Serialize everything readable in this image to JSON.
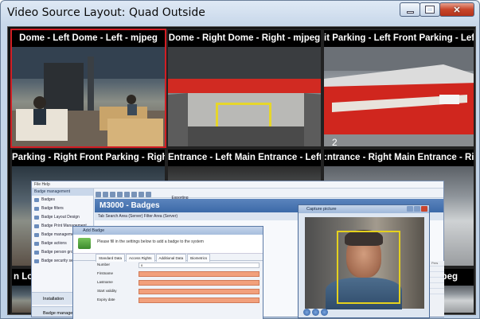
{
  "window": {
    "title": "Video Source Layout: Quad Outside",
    "controls": {
      "minimize": "minimize",
      "maximize": "maximize",
      "close": "close"
    }
  },
  "tiles": [
    {
      "label": "Dome - Left Dome - Left - mjpeg",
      "active": true
    },
    {
      "label": "Dome - Right Dome - Right - mjpeg",
      "active": false
    },
    {
      "label": "it Parking - Left Front Parking - Left - m",
      "active": false
    },
    {
      "label": "Parking - Right Front Parking - Right - r",
      "active": false
    },
    {
      "label": "Entrance - Left Main Entrance - Left - n",
      "active": false
    },
    {
      "label": ":ntrance - Right Main Entrance - Right - m",
      "active": false
    },
    {
      "label": "n Lo",
      "active": false
    },
    {
      "label": "njpeg",
      "active": false
    }
  ],
  "overlay_app": {
    "menubar": "File   Help",
    "nav_header": "Badge management",
    "nav_items": [
      "Badges",
      "Badge filters",
      "Badge Layout Design",
      "Badge Print Management",
      "Badge management",
      "Badge actions",
      "Badge person groups",
      "Badge security settings"
    ],
    "nav_bottom_1": "Installation",
    "nav_bottom_2": "Badge management",
    "header": "M3000 - Badges",
    "tabs": "Tab Search Area (Server)   Filter Area (Server)",
    "toolbar_export": "Exporting"
  },
  "add_badge_dialog": {
    "title": "Add Badge",
    "banner_text": "Please fill in the settings below to add a badge to the system",
    "tabs": [
      "Standard Data",
      "Access Rights",
      "Additional Data",
      "Biometrics"
    ],
    "fields": [
      {
        "label": "Number",
        "value": "0"
      },
      {
        "label": "Firstname",
        "value": ""
      },
      {
        "label": "Lastname",
        "value": ""
      },
      {
        "label": "Start validity",
        "value": ""
      },
      {
        "label": "Expiry date",
        "value": ""
      }
    ]
  },
  "capture_window": {
    "title": "Capture picture"
  },
  "right_list": {
    "header": "Pers"
  }
}
